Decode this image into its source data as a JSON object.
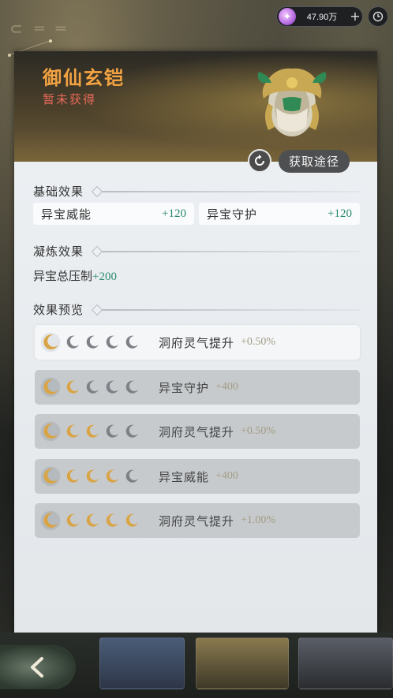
{
  "currency": {
    "amount": "47.90万",
    "icon": "spirit-gem-icon",
    "plus": "+"
  },
  "item": {
    "name": "御仙玄铠",
    "status": "暂未获得",
    "image": "armor-illustration"
  },
  "actions": {
    "source_label": "获取途径"
  },
  "base_effects": {
    "title": "基础效果",
    "stats": [
      {
        "name": "异宝威能",
        "value": "+120"
      },
      {
        "name": "异宝守护",
        "value": "+120"
      }
    ]
  },
  "refine_effects": {
    "title": "凝炼效果",
    "label": "异宝总压制",
    "value": "+200"
  },
  "preview": {
    "title": "效果预览",
    "rows": [
      {
        "filled": 1,
        "label": "洞府灵气提升",
        "value": "+0.50%",
        "active": true
      },
      {
        "filled": 2,
        "label": "异宝守护",
        "value": "+400",
        "active": false
      },
      {
        "filled": 3,
        "label": "洞府灵气提升",
        "value": "+0.50%",
        "active": false
      },
      {
        "filled": 4,
        "label": "异宝威能",
        "value": "+400",
        "active": false
      },
      {
        "filled": 5,
        "label": "洞府灵气提升",
        "value": "+1.00%",
        "active": false
      }
    ]
  },
  "colors": {
    "name": "#f3a342",
    "status": "#e86a5a",
    "stat_value": "#2a8a6e",
    "preview_value": "#a39c84",
    "moon_gold": "#d9a445",
    "moon_grey": "#7d8186"
  }
}
